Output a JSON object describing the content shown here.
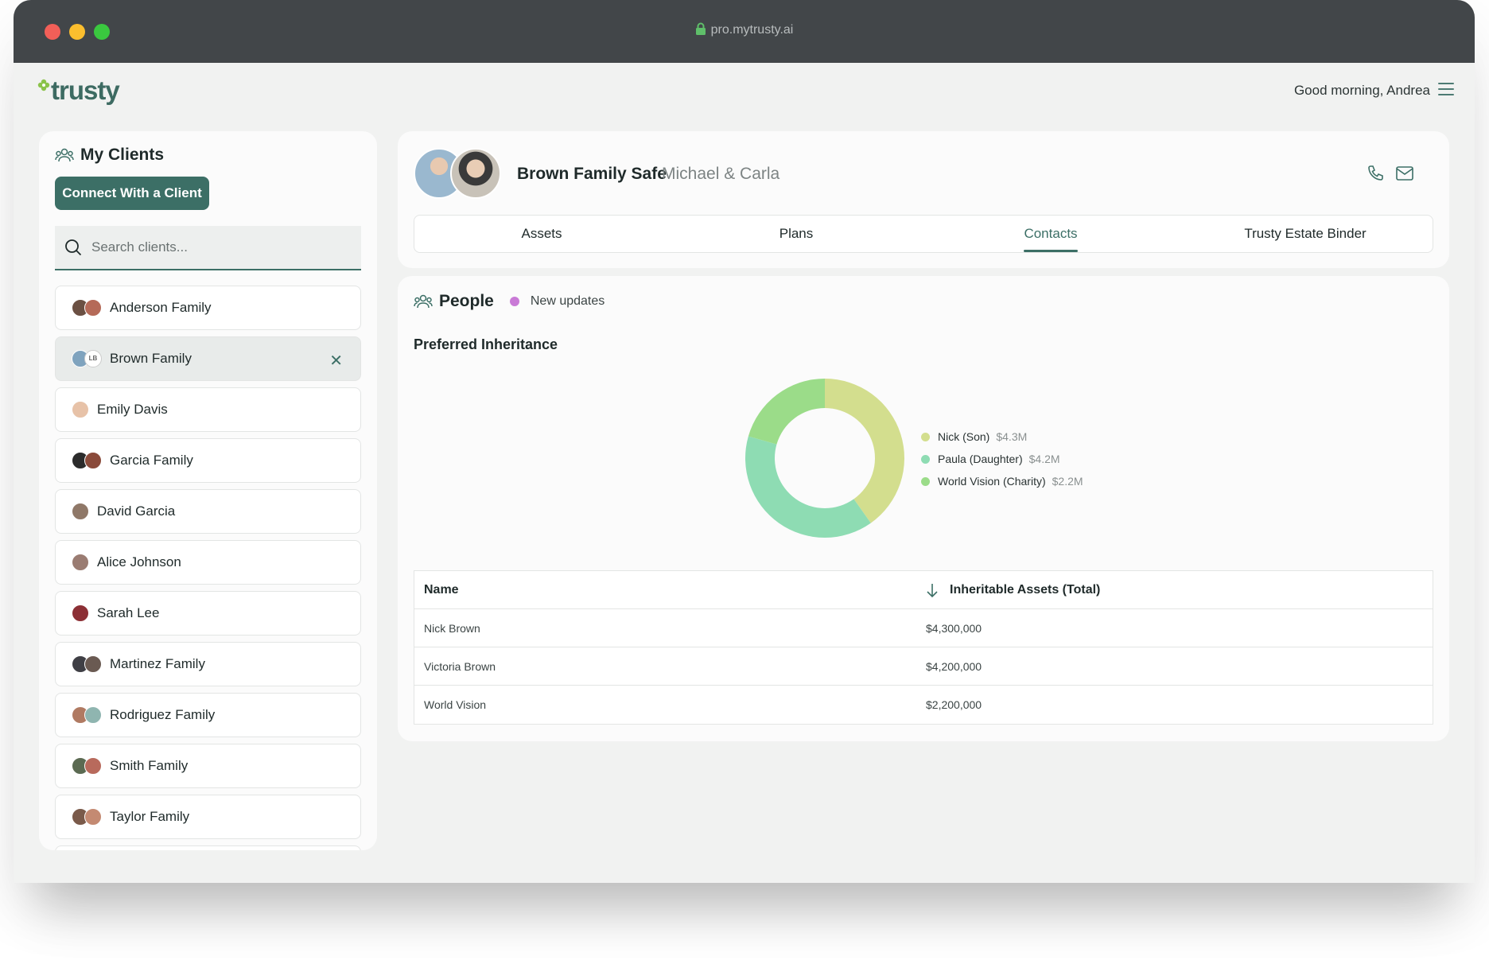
{
  "browser": {
    "url": "pro.mytrusty.ai"
  },
  "app": {
    "logo": "trusty",
    "greeting": "Good morning, Andrea"
  },
  "sidebar": {
    "title": "My Clients",
    "connect_button": "Connect With a Client",
    "search_placeholder": "Search clients...",
    "clients": [
      {
        "label": "Anderson Family",
        "active": false
      },
      {
        "label": "Brown Family",
        "active": true,
        "badge": "LB"
      },
      {
        "label": "Emily Davis",
        "active": false
      },
      {
        "label": "Garcia Family",
        "active": false
      },
      {
        "label": "David Garcia",
        "active": false
      },
      {
        "label": "Alice Johnson",
        "active": false
      },
      {
        "label": "Sarah Lee",
        "active": false
      },
      {
        "label": "Martinez Family",
        "active": false
      },
      {
        "label": "Rodriguez Family",
        "active": false
      },
      {
        "label": "Smith Family",
        "active": false
      },
      {
        "label": "Taylor Family",
        "active": false
      }
    ]
  },
  "header": {
    "title": "Brown Family Safe",
    "subtitle": "Michael & Carla",
    "tabs": [
      {
        "label": "Assets",
        "active": false
      },
      {
        "label": "Plans",
        "active": false
      },
      {
        "label": "Contacts",
        "active": true
      },
      {
        "label": "Trusty Estate Binder",
        "active": false
      }
    ]
  },
  "people": {
    "title": "People",
    "updates_label": "New updates",
    "section_title": "Preferred Inheritance",
    "legend": [
      {
        "name": "Nick (Son)",
        "value": "$4.3M",
        "color": "#d3de8e"
      },
      {
        "name": "Paula (Daughter)",
        "value": "$4.2M",
        "color": "#8edcb3"
      },
      {
        "name": "World Vision (Charity)",
        "value": "$2.2M",
        "color": "#9bdc89"
      }
    ],
    "table": {
      "headers": [
        "Name",
        "Inheritable Assets (Total)"
      ],
      "rows": [
        [
          "Nick Brown",
          "$4,300,000"
        ],
        [
          "Victoria Brown",
          "$4,200,000"
        ],
        [
          "World Vision",
          "$2,200,000"
        ]
      ]
    }
  },
  "colors": {
    "brand": "#3c6f66",
    "titlebar": "#424649",
    "background": "#f1f2f1",
    "update_dot": "#c97ad6"
  },
  "chart_data": {
    "type": "pie",
    "categories": [
      "Nick (Son)",
      "Paula (Daughter)",
      "World Vision (Charity)"
    ],
    "values": [
      4.3,
      4.2,
      2.2
    ],
    "title": "",
    "donut": true
  }
}
